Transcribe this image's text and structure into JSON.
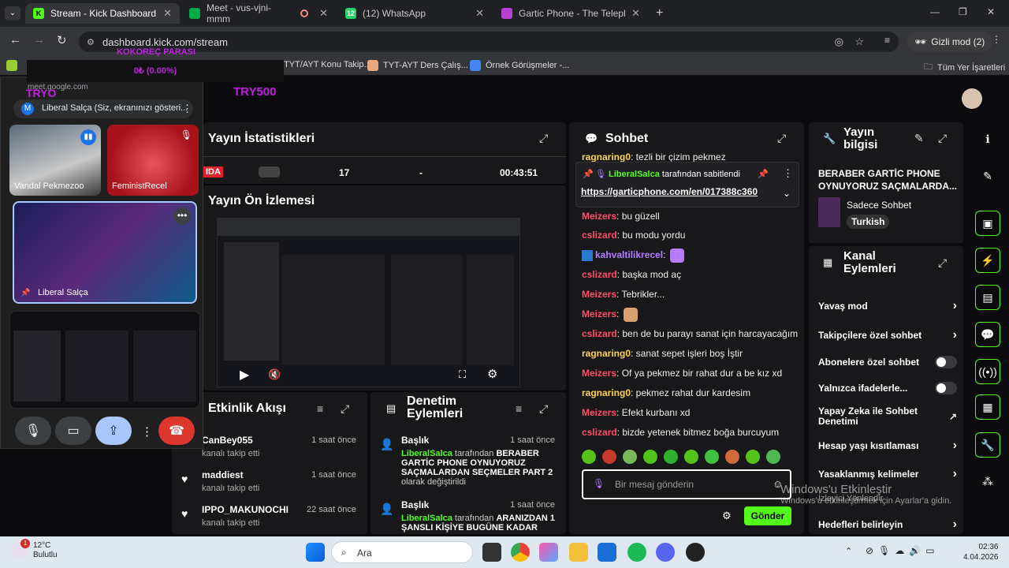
{
  "browser": {
    "tabs": [
      {
        "label": "Stream - Kick Dashboard",
        "icon": "kick-icon",
        "active": true
      },
      {
        "label": "Meet - vus-vjni-mmm",
        "icon": "meet-icon"
      },
      {
        "label": "(12) WhatsApp",
        "icon": "whatsapp-icon"
      },
      {
        "label": "Gartic Phone - The Telephone G",
        "icon": "gartic-icon"
      }
    ],
    "url": "dashboard.kick.com/stream",
    "profile": "Gizli mod (2)",
    "bookmarks": [
      "TYT/AYT Konu Takip...",
      "TYT-AYT Ders Çalış...",
      "Örnek Görüşmeler -..."
    ],
    "all_bookmarks": "Tüm Yer İşaretleri"
  },
  "overlay": {
    "kokorec": "KOKOREÇ PARASI",
    "percent": "0₺ (0.00%)",
    "tryo": "TRYO",
    "try500": "TRY500"
  },
  "meet": {
    "url": "meet.google.com",
    "presenting": "Liberal Salça (Siz, ekranınızı gösteri...",
    "avatar_letter": "M",
    "tiles": [
      "Vandal Pekmezoo",
      "FeministRecel",
      "Liberal Salça"
    ]
  },
  "stats": {
    "title": "Yayın İstatistikleri",
    "badge": "IDA",
    "viewers": "17",
    "dash": "-",
    "duration": "00:43:51"
  },
  "preview": {
    "title": "Yayın Ön İzlemesi"
  },
  "activity": {
    "title": "Etkinlik Akışı",
    "items": [
      {
        "user": "CanBey055",
        "time": "1 saat önce",
        "action": "kanalı takip etti"
      },
      {
        "user": "maddiest",
        "time": "1 saat önce",
        "action": "kanalı takip etti"
      },
      {
        "user": "IPPO_MAKUNOCHI",
        "time": "22 saat önce",
        "action": "kanalı takip etti"
      }
    ]
  },
  "moderation": {
    "title": "Denetim Eylemleri",
    "items": [
      {
        "label": "Başlık",
        "time": "1 saat önce",
        "actor": "LiberalSalca",
        "mid": " tarafından ",
        "text": "BERABER GARTİC PHONE OYNUYORUZ SAÇMALARDAN SEÇMELER PART 2",
        "tail": "olarak değiştirildi"
      },
      {
        "label": "Başlık",
        "time": "1 saat önce",
        "actor": "LiberalSalca",
        "mid": " tarafından ",
        "text": "ARANIZDAN 1 ŞANSLI KİŞİYE BUGÜNE KADAR",
        "tail": ""
      }
    ]
  },
  "chat": {
    "title": "Sohbet",
    "top_line": {
      "user": "ragnaring0",
      "text": ": tezli bir çizim pekmez"
    },
    "pinned": {
      "by": "LiberalSalca",
      "suffix": " tarafından sabitlendi",
      "link": "https://garticphone.com/en/017388c360"
    },
    "messages": [
      {
        "user": "Meizers",
        "color": "#ff4d6a",
        "text": ": bu güzell"
      },
      {
        "user": "cslizard",
        "color": "#ff4d6a",
        "text": ": bu modu yordu"
      },
      {
        "user": "kahvaltilikrecel",
        "color": "#b57cff",
        "text": ":"
      },
      {
        "user": "cslizard",
        "color": "#ff4d6a",
        "text": ": başka mod aç"
      },
      {
        "user": "Meizers",
        "color": "#ff4d6a",
        "text": ": Tebrikler..."
      },
      {
        "user": "Meizers",
        "color": "#ff4d6a",
        "text": ":"
      },
      {
        "user": "cslizard",
        "color": "#ff4d6a",
        "text": ": ben de bu parayı sanat için harcayacağım"
      },
      {
        "user": "ragnaring0",
        "color": "#ffd24d",
        "text": ": sanat sepet işleri boş İştir"
      },
      {
        "user": "Meizers",
        "color": "#ff4d6a",
        "text": ": Of ya pekmez bir rahat dur a be kız xd"
      },
      {
        "user": "ragnaring0",
        "color": "#ffd24d",
        "text": ": pekmez rahat dur kardesim"
      },
      {
        "user": "Meizers",
        "color": "#ff4d6a",
        "text": ": Efekt kurbanı xd"
      },
      {
        "user": "cslizard",
        "color": "#ff4d6a",
        "text": ": bizde yetenek bitmez boğa burcuyum"
      }
    ],
    "placeholder": "Bir mesaj gönderin",
    "send": "Gönder"
  },
  "stream_info": {
    "title": "Yayın bilgisi",
    "stream_title": "BERABER GARTİC PHONE OYNUYORUZ SAÇMALARDA...",
    "category": "Sadece Sohbet",
    "language": "Turkish"
  },
  "channel_actions": {
    "title": "Kanal Eylemleri",
    "rows": [
      {
        "label": "Yavaş mod",
        "kind": "chev"
      },
      {
        "label": "Takipçilere özel sohbet",
        "kind": "chev"
      },
      {
        "label": "Abonelere özel sohbet",
        "kind": "toggle"
      },
      {
        "label": "Yalnızca ifadelerle...",
        "kind": "toggle"
      },
      {
        "label": "Yapay Zeka ile Sohbet Denetimi",
        "kind": "ext"
      },
      {
        "label": "Hesap yaşı kısıtlaması",
        "kind": "chev"
      },
      {
        "label": "Yasaklanmış kelimeler",
        "kind": "chev"
      },
      {
        "label": "Hedefleri belirleyin",
        "kind": "chev"
      }
    ]
  },
  "watermark": {
    "line1": "Windows'u Etkinleştir",
    "line2": "Windows'u etkinleştirmek için Ayarlar'a gidin.",
    "izleyici": "İzleyici Yönlendir"
  },
  "taskbar": {
    "weather_temp": "12°C",
    "weather_text": "Bulutlu",
    "badge": "1",
    "search": "Ara",
    "time": "02:36",
    "date": "4.04.2026"
  }
}
